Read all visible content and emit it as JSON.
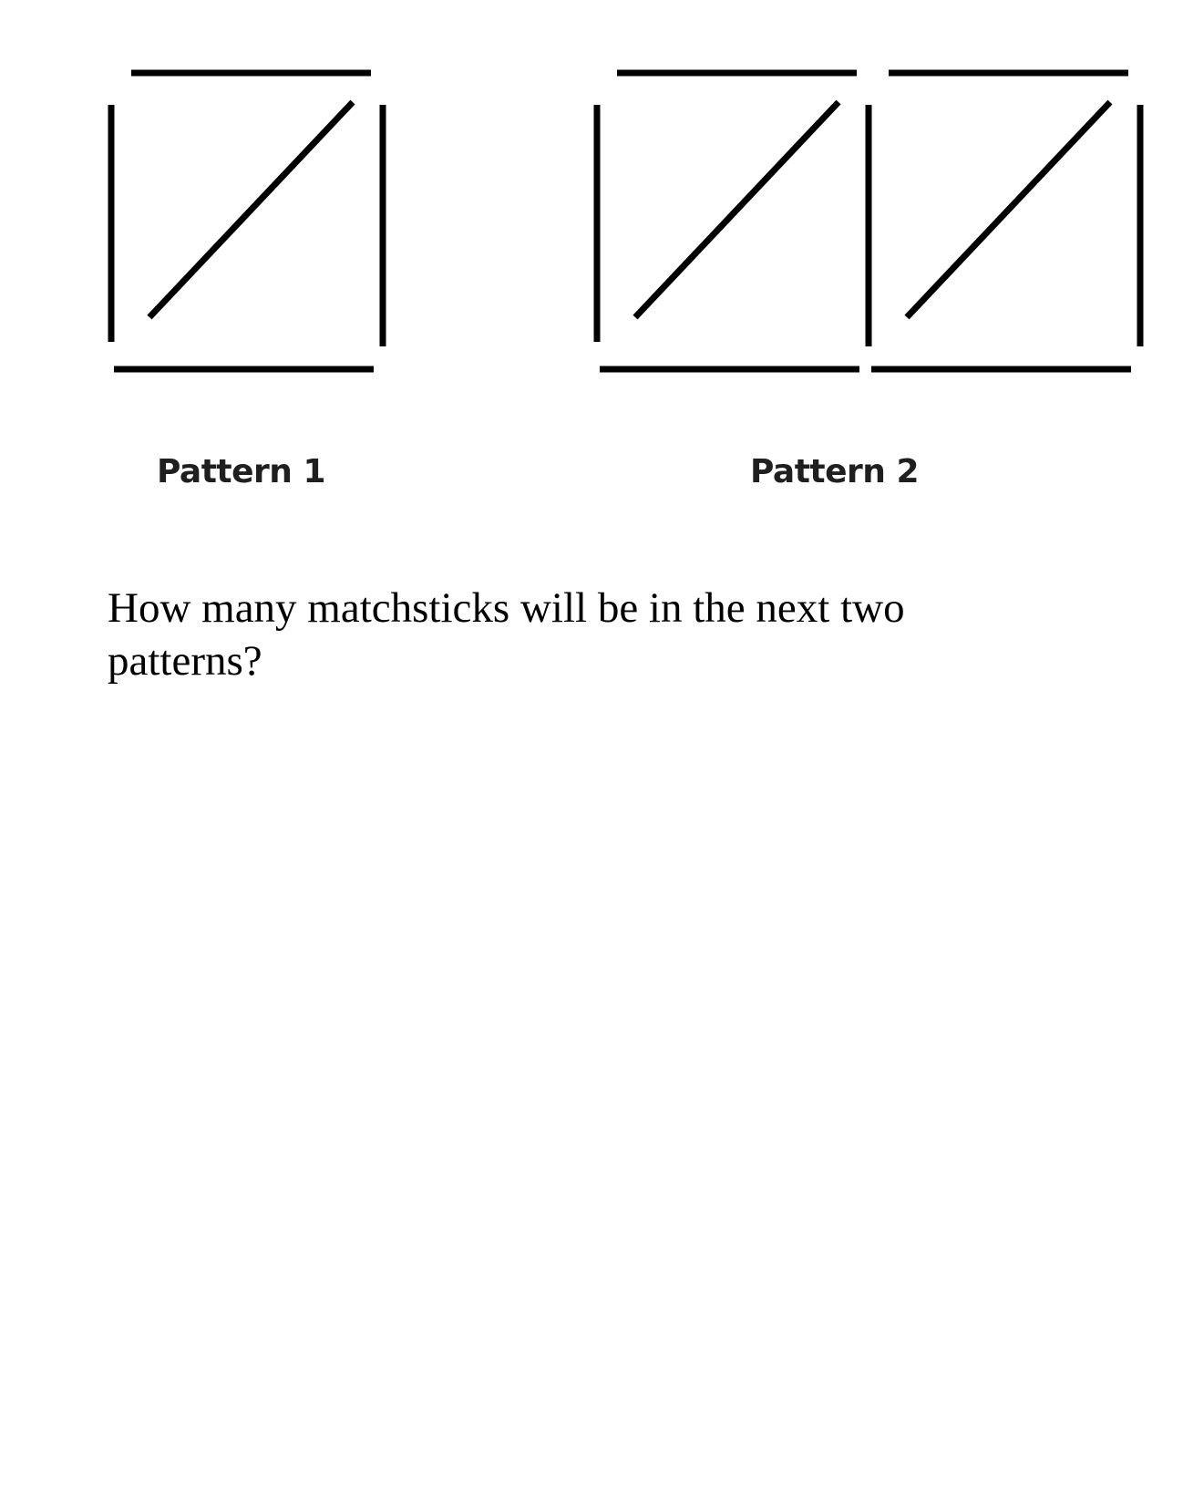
{
  "patterns": [
    {
      "label": "Pattern 1",
      "squares": 1
    },
    {
      "label": "Pattern 2",
      "squares": 2
    }
  ],
  "question": "How many matchsticks will be in the next two patterns?",
  "stick_color": "#000000"
}
